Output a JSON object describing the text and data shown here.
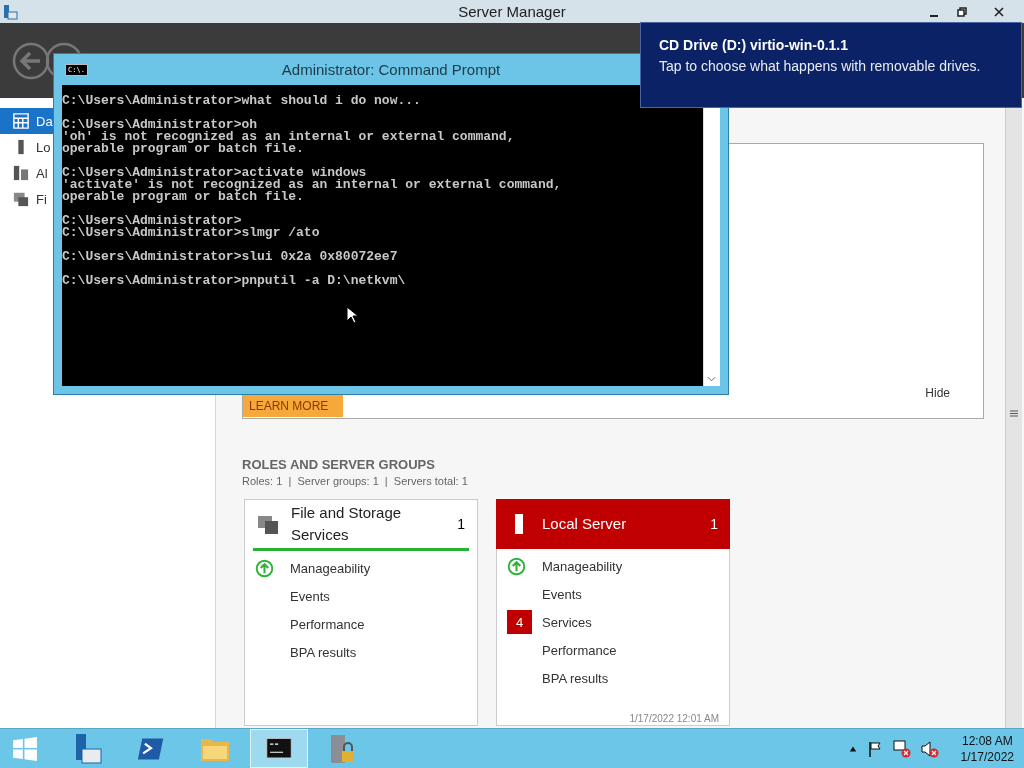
{
  "window": {
    "title": "Server Manager"
  },
  "sidebar": {
    "items": [
      {
        "label": "Da",
        "selected": true
      },
      {
        "label": "Lo",
        "selected": false
      },
      {
        "label": "Al",
        "selected": false
      },
      {
        "label": "Fi",
        "selected": false
      }
    ]
  },
  "welcome_panel": {
    "learn_more": "LEARN MORE",
    "hide": "Hide"
  },
  "roles": {
    "heading": "ROLES AND SERVER GROUPS",
    "summary": "Roles: 1  |  Server groups: 1  |  Servers total: 1",
    "cards": [
      {
        "title": "File and Storage Services",
        "count": "1",
        "kind": "ok",
        "items": [
          {
            "label": "Manageability",
            "kind": "ok"
          },
          {
            "label": "Events",
            "kind": "plain"
          },
          {
            "label": "Performance",
            "kind": "plain"
          },
          {
            "label": "BPA results",
            "kind": "plain"
          }
        ]
      },
      {
        "title": "Local Server",
        "count": "1",
        "kind": "alert",
        "timestamp": "1/17/2022 12:01 AM",
        "items": [
          {
            "label": "Manageability",
            "kind": "ok"
          },
          {
            "label": "Events",
            "kind": "plain"
          },
          {
            "label": "Services",
            "kind": "alert",
            "badge": "4"
          },
          {
            "label": "Performance",
            "kind": "plain"
          },
          {
            "label": "BPA results",
            "kind": "plain"
          }
        ]
      }
    ]
  },
  "command_prompt": {
    "title": "Administrator: Command Prompt",
    "icon_text": "C:\\.",
    "blocks": [
      [
        "C:\\Users\\Administrator>what should i do now..."
      ],
      [
        "C:\\Users\\Administrator>oh",
        "'oh' is not recognized as an internal or external command,",
        "operable program or batch file."
      ],
      [
        "C:\\Users\\Administrator>activate windows",
        "'activate' is not recognized as an internal or external command,",
        "operable program or batch file."
      ],
      [
        "C:\\Users\\Administrator>",
        "C:\\Users\\Administrator>slmgr /ato"
      ],
      [
        "C:\\Users\\Administrator>slui 0x2a 0x80072ee7"
      ],
      [
        "C:\\Users\\Administrator>pnputil -a D:\\netkvm\\"
      ]
    ]
  },
  "notification": {
    "title": "CD Drive (D:) virtio-win-0.1.1",
    "body": "Tap to choose what happens with removable drives."
  },
  "taskbar": {
    "items": [
      {
        "kind": "server-manager",
        "selected": false
      },
      {
        "kind": "powershell",
        "selected": false
      },
      {
        "kind": "explorer",
        "selected": false
      },
      {
        "kind": "cmd",
        "selected": true
      },
      {
        "kind": "locked-server",
        "selected": false
      }
    ],
    "clock": {
      "time": "12:08 AM",
      "date": "1/17/2022"
    }
  }
}
